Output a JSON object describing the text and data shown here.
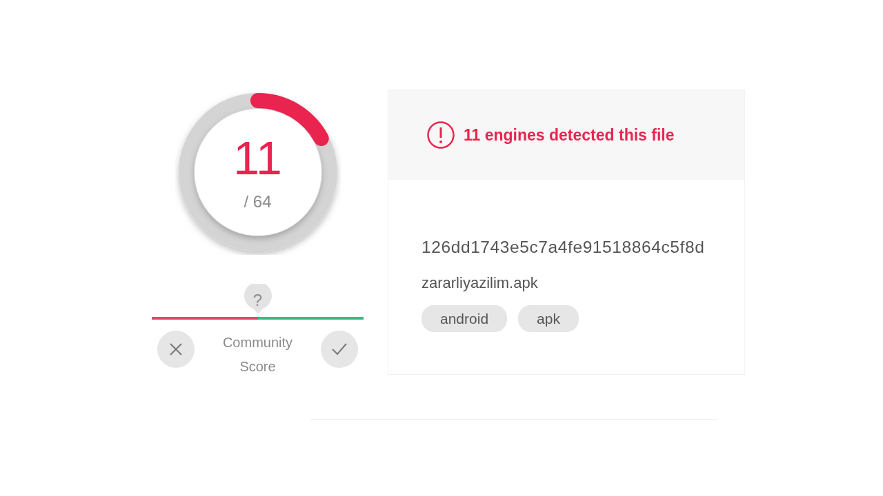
{
  "detection": {
    "detected": "11",
    "total": "/ 64"
  },
  "community": {
    "marker": "?",
    "label": "Community Score"
  },
  "alert": {
    "text": "11 engines detected this file"
  },
  "file": {
    "hash": "126dd1743e5c7a4fe91518864c5f8d",
    "name": "zararliyazilim.apk",
    "tags": [
      "android",
      "apk"
    ]
  }
}
